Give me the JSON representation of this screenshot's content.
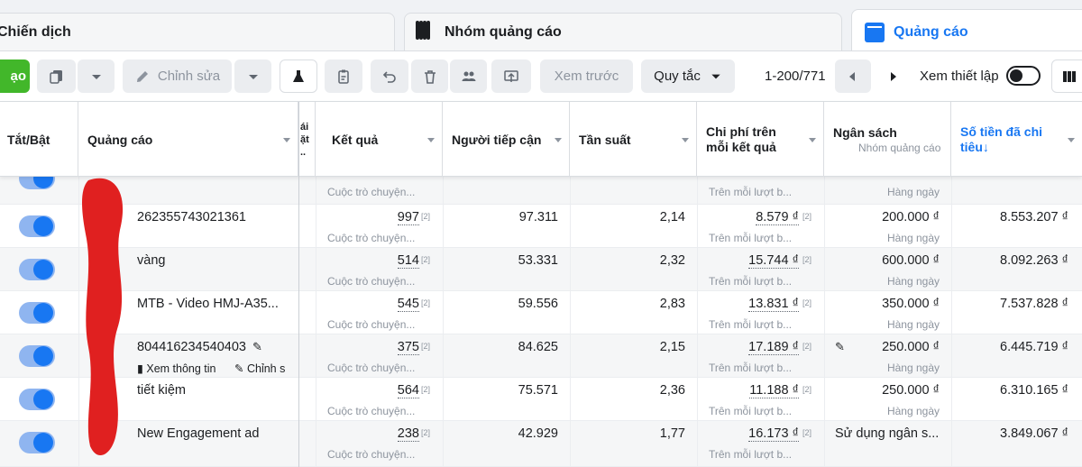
{
  "tabs": {
    "campaigns": "Chiến dịch",
    "adsets": "Nhóm quảng cáo",
    "ads": "Quảng cáo"
  },
  "toolbar": {
    "create_label": "ạo",
    "edit_label": "Chỉnh sửa",
    "preview_label": "Xem trước",
    "rules_label": "Quy tắc",
    "pager": "1-200/771",
    "settings_label": "Xem thiết lập"
  },
  "columns": {
    "toggle": "Tắt/Bật",
    "ad": "Quảng cáo",
    "delivery_partial": "ái\nặt\n..",
    "results": "Kết quả",
    "reach": "Người tiếp cận",
    "frequency": "Tần suất",
    "cpr": "Chi phí trên mỗi kết quả",
    "budget": "Ngân sách",
    "budget_sub": "Nhóm quảng cáo",
    "spent": "Số tiền đã chi tiêu↓"
  },
  "rows": [
    {
      "name": "",
      "result": "",
      "result_sub": "Cuộc trò chuyện...",
      "reach": "",
      "freq": "",
      "cpr": "",
      "cpr_sub": "Trên mỗi lượt b...",
      "budget": "",
      "budget_sub": "Hàng ngày",
      "spent": ""
    },
    {
      "name": "262355743021361",
      "result": "997",
      "result_sub": "Cuộc trò chuyện...",
      "reach": "97.311",
      "freq": "2,14",
      "cpr": "8.579 ₫",
      "cpr_sub": "Trên mỗi lượt b...",
      "budget": "200.000 ₫",
      "budget_sub": "Hàng ngày",
      "spent": "8.553.207 ₫"
    },
    {
      "name": "vàng",
      "result": "514",
      "result_sub": "Cuộc trò chuyện...",
      "reach": "53.331",
      "freq": "2,32",
      "cpr": "15.744 ₫",
      "cpr_sub": "Trên mỗi lượt b...",
      "budget": "600.000 ₫",
      "budget_sub": "Hàng ngày",
      "spent": "8.092.263 ₫"
    },
    {
      "name": "MTB - Video HMJ-A35...",
      "result": "545",
      "result_sub": "Cuộc trò chuyện...",
      "reach": "59.556",
      "freq": "2,83",
      "cpr": "13.831 ₫",
      "cpr_sub": "Trên mỗi lượt b...",
      "budget": "350.000 ₫",
      "budget_sub": "Hàng ngày",
      "spent": "7.537.828 ₫"
    },
    {
      "name": "804416234540403",
      "result": "375",
      "result_sub": "Cuộc trò chuyện...",
      "reach": "84.625",
      "freq": "2,15",
      "cpr": "17.189 ₫",
      "cpr_sub": "Trên mỗi lượt b...",
      "budget": "250.000 ₫",
      "budget_sub": "Hàng ngày",
      "spent": "6.445.719 ₫",
      "actions": {
        "view": "Xem thông tin",
        "edit": "Chỉnh s"
      }
    },
    {
      "name": "tiết kiệm",
      "result": "564",
      "result_sub": "Cuộc trò chuyện...",
      "reach": "75.571",
      "freq": "2,36",
      "cpr": "11.188 ₫",
      "cpr_sub": "Trên mỗi lượt b...",
      "budget": "250.000 ₫",
      "budget_sub": "Hàng ngày",
      "spent": "6.310.165 ₫"
    },
    {
      "name": "New Engagement ad",
      "result": "238",
      "result_sub": "Cuộc trò chuyện...",
      "reach": "42.929",
      "freq": "1,77",
      "cpr": "16.173 ₫",
      "cpr_sub": "Trên mỗi lượt b...",
      "budget": "Sử dụng ngân s...",
      "budget_sub": "",
      "spent": "3.849.067 ₫"
    }
  ],
  "footnote_mark": "[2]",
  "colors": {
    "accent": "#1877f2",
    "green": "#42b72a",
    "redmark": "#e02020"
  }
}
